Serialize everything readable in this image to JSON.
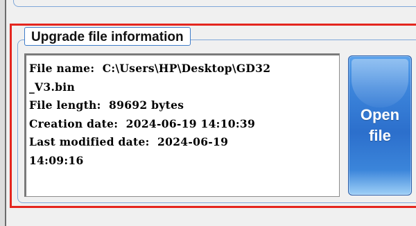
{
  "group": {
    "title": "Upgrade file information"
  },
  "file_info": {
    "lines": [
      "File name:  C:\\Users\\HP\\Desktop\\GD32",
      "_V3.bin",
      "File length:  89692 bytes",
      "Creation date:  2024-06-19 14:10:39",
      "Last modified date:  2024-06-19",
      "14:09:16"
    ]
  },
  "open_button": {
    "label": "Open\nfile"
  },
  "colors": {
    "highlight": "#e4261f",
    "group_border": "#7fa7d8",
    "button_blue": "#2c6fcc"
  }
}
